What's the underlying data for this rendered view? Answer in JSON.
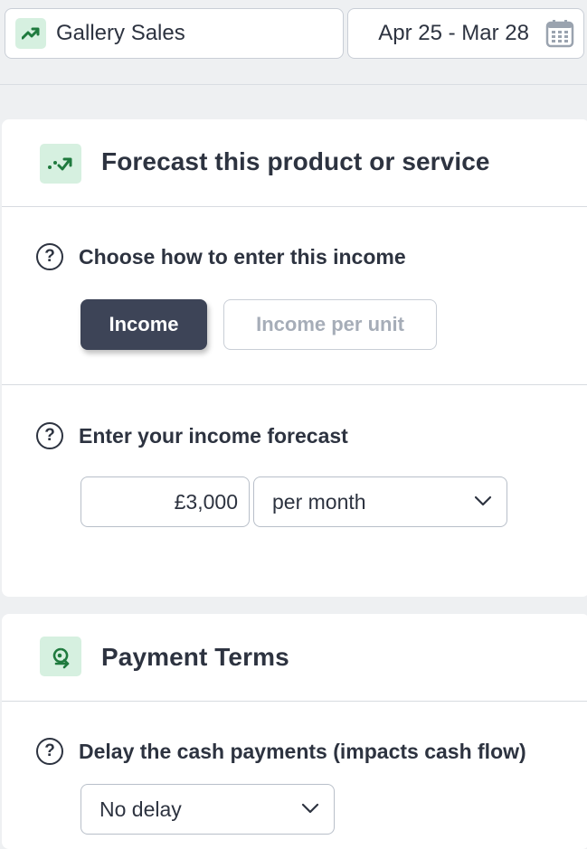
{
  "header": {
    "product_name": "Gallery Sales",
    "date_range": "Apr 25 - Mar 28",
    "icons": {
      "product": "trending-up-icon",
      "calendar": "calendar-icon"
    }
  },
  "forecast_card": {
    "title": "Forecast this product or service",
    "icon": "trend-arrow-icon",
    "entry_method": {
      "label": "Choose how to enter this income",
      "options": [
        "Income",
        "Income per unit"
      ],
      "selected": "Income"
    },
    "income_forecast": {
      "label": "Enter your income forecast",
      "amount": "£3,000",
      "period": "per month"
    }
  },
  "payment_card": {
    "title": "Payment Terms",
    "icon": "payment-arrow-icon",
    "delay": {
      "label": "Delay the cash payments (impacts cash flow)",
      "value": "No delay"
    }
  },
  "help_icon_glyph": "?",
  "colors": {
    "accent_green": "#1f7a3e",
    "badge_bg": "#d6f0e0",
    "active_button": "#3d4457",
    "text": "#2d3340",
    "muted_text": "#a6adb8"
  }
}
